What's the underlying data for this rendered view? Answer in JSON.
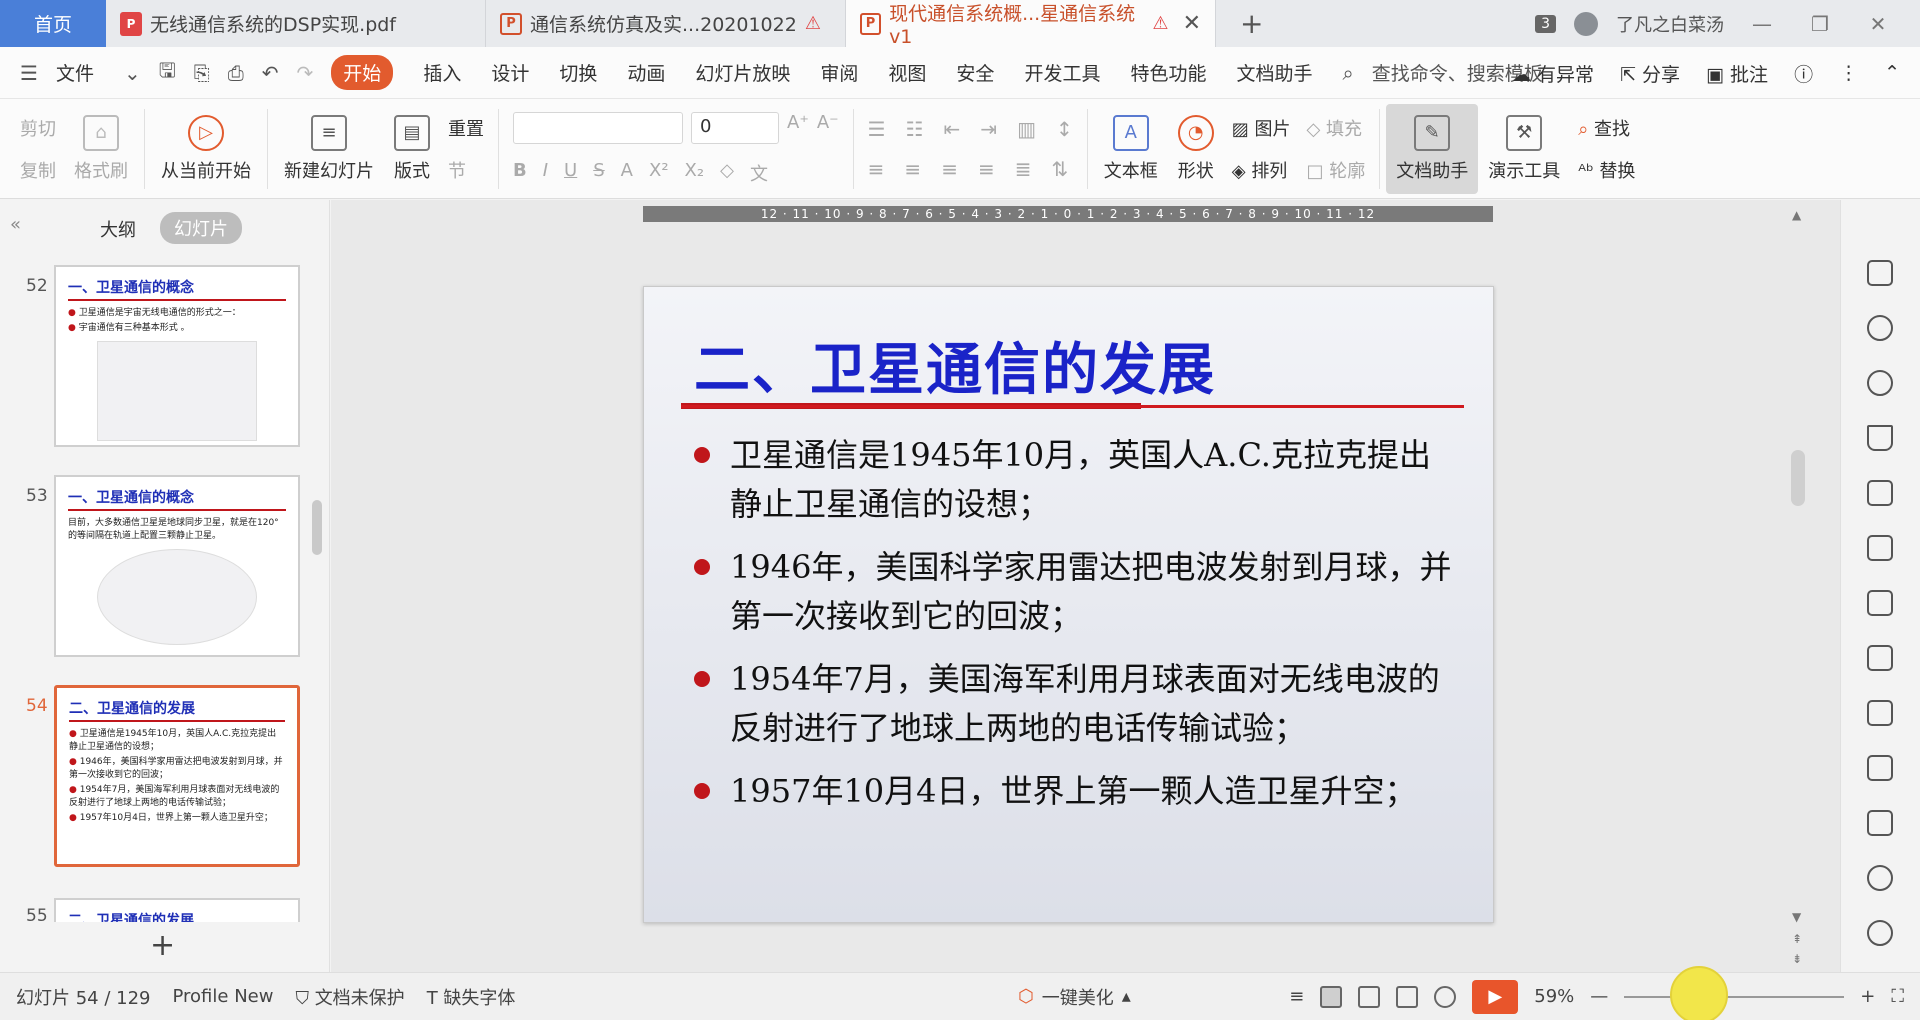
{
  "tabs": {
    "home": "首页",
    "items": [
      {
        "label": "无线通信系统的DSP实现.pdf",
        "type": "pdf",
        "warning": false
      },
      {
        "label": "通信系统仿真及实...20201022",
        "type": "ppt",
        "warning": true
      },
      {
        "label": "现代通信系统概...星通信系统v1",
        "type": "ppt",
        "warning": true,
        "active": true
      }
    ],
    "window_count": "3",
    "user": "了凡之白菜汤"
  },
  "menu": {
    "file": "文件",
    "items": [
      "开始",
      "插入",
      "设计",
      "切换",
      "动画",
      "幻灯片放映",
      "审阅",
      "视图",
      "安全",
      "开发工具",
      "特色功能",
      "文档助手"
    ],
    "search_placeholder": "查找命令、搜索模板",
    "anomaly": "有异常",
    "share": "分享",
    "annotate": "批注"
  },
  "ribbon": {
    "cut": "剪切",
    "copy": "复制",
    "format_painter": "格式刷",
    "from_current": "从当前开始",
    "new_slide": "新建幻灯片",
    "layout": "版式",
    "reset": "重置",
    "section": "节",
    "font_size": "0",
    "textbox": "文本框",
    "shape": "形状",
    "picture": "图片",
    "arrange": "排列",
    "fill": "填充",
    "outline": "轮廓",
    "doc_helper": "文档助手",
    "present_tools": "演示工具",
    "find": "查找",
    "replace": "替换"
  },
  "leftpanel": {
    "outline_tab": "大纲",
    "slides_tab": "幻灯片",
    "thumbs": [
      {
        "num": "52",
        "title": "一、卫星通信的概念",
        "lines": [
          "卫星通信是宇宙无线电通信的形式之一：",
          "宇宙通信有三种基本形式 。"
        ]
      },
      {
        "num": "53",
        "title": "一、卫星通信的概念",
        "lines": [
          "目前，大多数通信卫星是地球同步卫星，就是在120°的等间隔在轨道上配置三颗静止卫星。"
        ]
      },
      {
        "num": "54",
        "title": "二、卫星通信的发展",
        "lines": [
          "卫星通信是1945年10月，英国人A.C.克拉克提出静止卫星通信的设想；",
          "1946年，美国科学家用雷达把电波发射到月球，并第一次接收到它的回波；",
          "1954年7月，美国海军利用月球表面对无线电波的反射进行了地球上两地的电话传输试验；",
          "1957年10月4日，世界上第一颗人造卫星升空；"
        ]
      },
      {
        "num": "55",
        "title": "二、卫星通信的发展",
        "lines": []
      }
    ]
  },
  "slide": {
    "title": "二、卫星通信的发展",
    "bullets": [
      "卫星通信是1945年10月，英国人A.C.克拉克提出静止卫星通信的设想；",
      "1946年，美国科学家用雷达把电波发射到月球，并第一次接收到它的回波；",
      "1954年7月，美国海军利用月球表面对无线电波的反射进行了地球上两地的电话传输试验；",
      "1957年10月4日，世界上第一颗人造卫星升空；"
    ],
    "ruler": "12 · 11 · 10 · 9 · 8 · 7 · 6 · 5 · 4 · 3 · 2 · 1 · 0 · 1 · 2 · 3 · 4 · 5 · 6 · 7 · 8 · 9 · 10 · 11 · 12"
  },
  "status": {
    "slide_counter": "幻灯片 54 / 129",
    "theme": "Profile New",
    "protection": "文档未保护",
    "missing_font": "缺失字体",
    "beautify": "一键美化",
    "zoom": "59%"
  },
  "colors": {
    "accent": "#e25b2e",
    "title_blue": "#1a23c8",
    "bullet_red": "#c0161b",
    "home_tab": "#4a7fd8"
  }
}
